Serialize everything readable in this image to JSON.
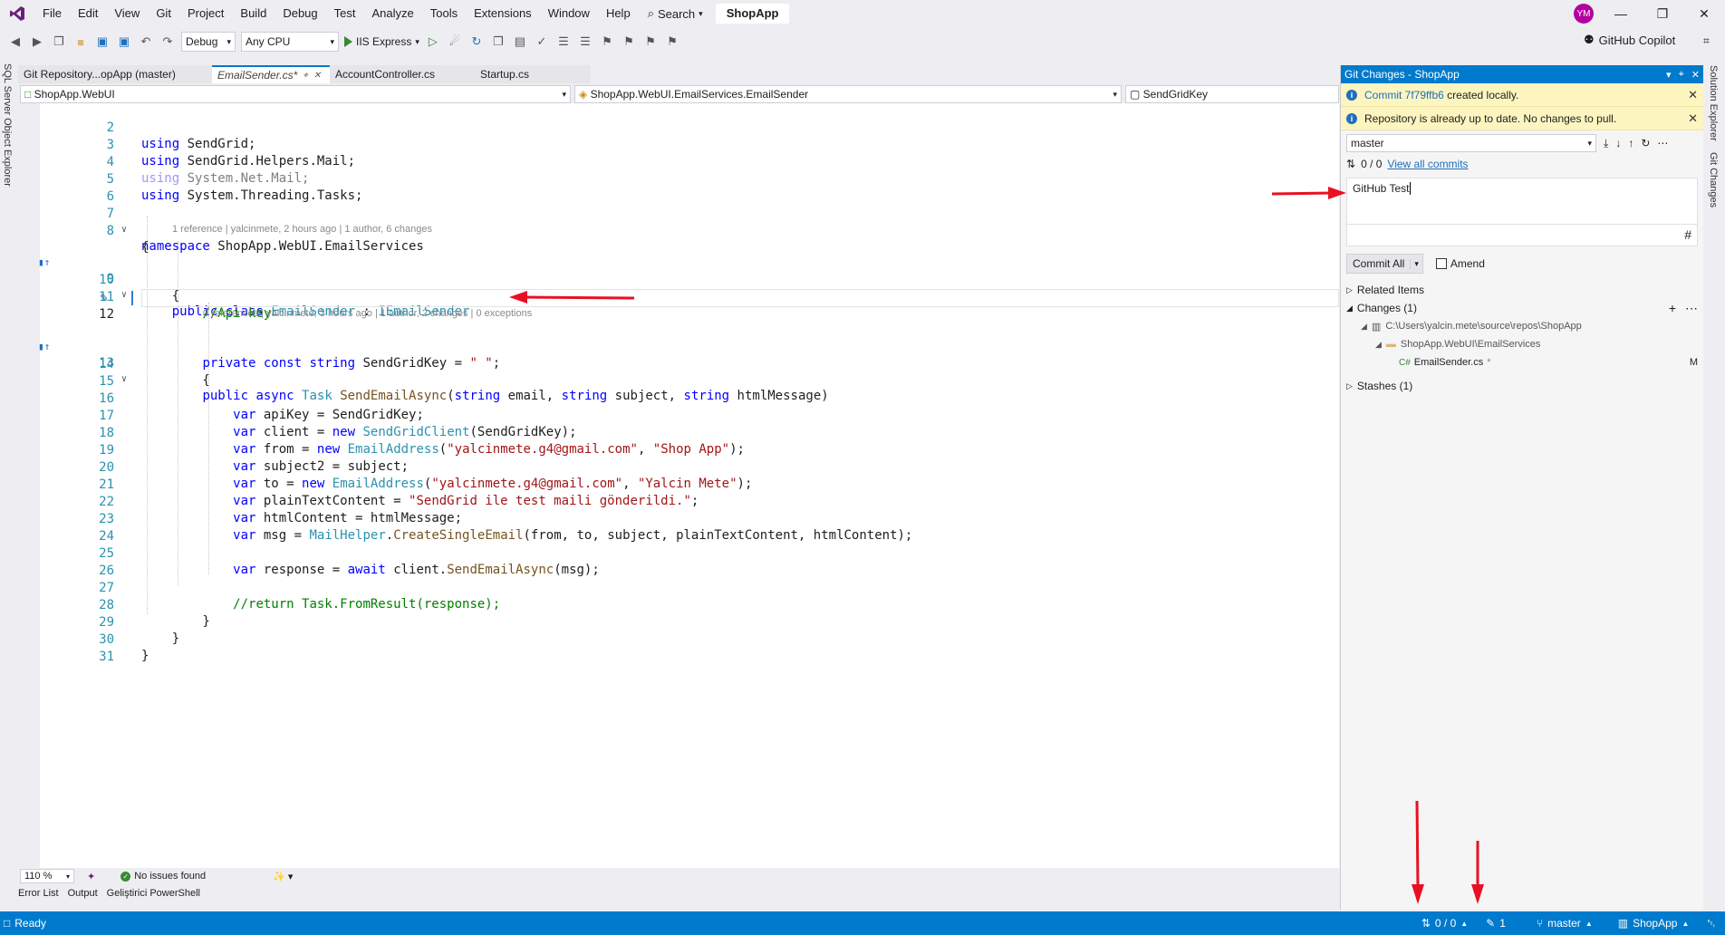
{
  "menubar": {
    "items": [
      "File",
      "Edit",
      "View",
      "Git",
      "Project",
      "Build",
      "Debug",
      "Test",
      "Analyze",
      "Tools",
      "Extensions",
      "Window",
      "Help"
    ],
    "search_label": "Search",
    "project_name": "ShopApp",
    "avatar_initials": "YM",
    "brand_color": "#68217a"
  },
  "toolbar": {
    "config": "Debug",
    "platform": "Any CPU",
    "run_label": "IIS Express",
    "copilot_label": "GitHub Copilot"
  },
  "left_strip": {
    "label": "SQL Server Object Explorer"
  },
  "right_strip": {
    "labels": [
      "Solution Explorer",
      "Git Changes"
    ]
  },
  "tabs": [
    {
      "label": "Git Repository...opApp (master)",
      "active": false
    },
    {
      "label": "EmailSender.cs*",
      "active": true
    },
    {
      "label": "AccountController.cs",
      "active": false
    },
    {
      "label": "Startup.cs",
      "active": false
    }
  ],
  "nav": {
    "project": "ShopApp.WebUI",
    "type": "ShopApp.WebUI.EmailServices.EmailSender",
    "member": "SendGridKey"
  },
  "code": {
    "line_numbers": [
      "2",
      "3",
      "4",
      "5",
      "6",
      "7",
      "8",
      "9",
      "10",
      "11",
      "12",
      "13",
      "14",
      "15",
      "16",
      "17",
      "18",
      "19",
      "20",
      "21",
      "22",
      "23",
      "24",
      "25",
      "26",
      "27",
      "28",
      "29",
      "30",
      "31"
    ],
    "hint_class": "1 reference | yalcinmete, 2 hours ago | 1 author, 6 changes",
    "hint_method": "0 references | yalcinmete, 3 hours ago | 1 author, 2 changes | 0 exceptions"
  },
  "editor_status": {
    "zoom": "110 %",
    "issues": "No issues found"
  },
  "bottom_tabs": [
    "Error List",
    "Output",
    "Geliştirici PowerShell"
  ],
  "statusbar": {
    "ready": "Ready",
    "sync": "0 / 0",
    "pending_changes": "1",
    "branch": "master",
    "repo": "ShopApp",
    "bg_color": "#007acc"
  },
  "git_panel": {
    "title": "Git Changes - ShopApp",
    "info_commit_link": "Commit 7f79ffb6",
    "info_commit_rest": " created locally.",
    "info_uptodate": "Repository is already up to date. No changes to pull.",
    "branch": "master",
    "sync_count": "0 / 0",
    "view_all_commits": "View all commits",
    "commit_message": "GitHub Test",
    "commit_all": "Commit All",
    "amend": "Amend",
    "related_items": "Related Items",
    "changes": "Changes (1)",
    "repo_path": "C:\\Users\\yalcin.mete\\source\\repos\\ShopApp",
    "folder": "ShopApp.WebUI\\EmailServices",
    "file": "EmailSender.cs",
    "file_mark": "*",
    "file_status": "M",
    "stashes": "Stashes (1)"
  }
}
